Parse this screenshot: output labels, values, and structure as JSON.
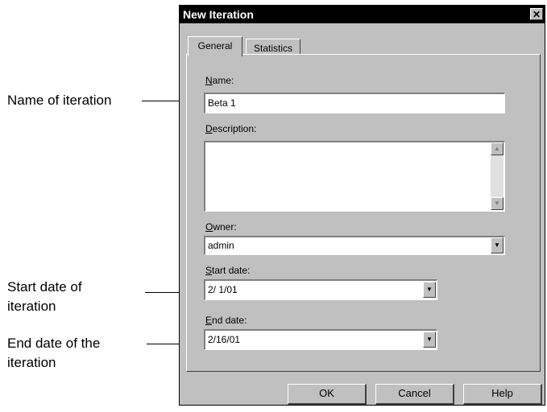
{
  "callouts": {
    "name": "Name of iteration",
    "start_line1": "Start date of",
    "start_line2": "iteration",
    "end_line1": "End date of the",
    "end_line2": "iteration"
  },
  "dialog": {
    "title": "New Iteration",
    "close_glyph": "✕",
    "tabs": [
      "General",
      "Statistics"
    ],
    "name_label_accel": "N",
    "name_label_rest": "ame:",
    "name_value": "Beta 1",
    "description_label_accel": "D",
    "description_label_rest": "escription:",
    "description_value": "",
    "owner_label_accel": "O",
    "owner_label_rest": "wner:",
    "owner_value": "admin",
    "start_label_accel": "S",
    "start_label_rest": "tart date:",
    "start_value": " 2/ 1/01",
    "end_label_accel": "E",
    "end_label_rest": "nd date:",
    "end_value": " 2/16/01",
    "buttons": {
      "ok": "OK",
      "cancel": "Cancel",
      "help": "Help"
    },
    "dropdown_glyph": "▼",
    "scroll_up_glyph": "▲",
    "scroll_down_glyph": "▼"
  }
}
